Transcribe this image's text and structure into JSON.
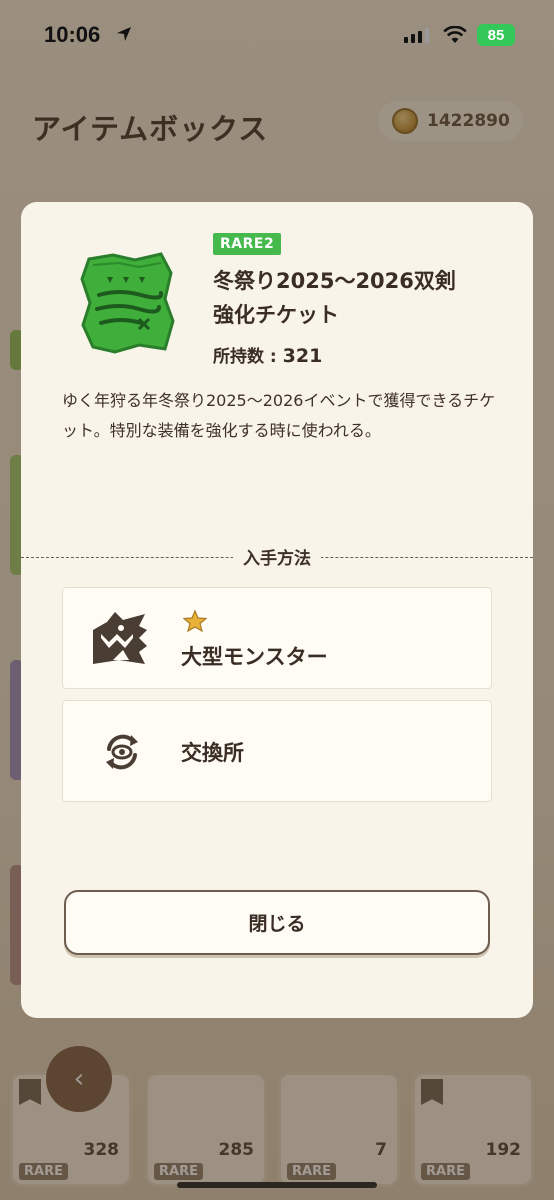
{
  "status_bar": {
    "time": "10:06",
    "battery": "85"
  },
  "background": {
    "title": "アイテムボックス",
    "coins": "1422890",
    "bottom_labels": [
      "",
      "",
      "",
      ""
    ],
    "slots": [
      {
        "count": "328",
        "rarity": "RARE"
      },
      {
        "count": "285",
        "rarity": "RARE"
      },
      {
        "count": "7",
        "rarity": "RARE"
      },
      {
        "count": "192",
        "rarity": "RARE"
      }
    ]
  },
  "modal": {
    "rarity": "RARE2",
    "rarity_color": "#46b94c",
    "item_name_line1": "冬祭り2025〜2026双剣",
    "item_name_line2": "強化チケット",
    "holding_label": "所持数 : ",
    "holding_count": "321",
    "description": "ゆく年狩る年冬祭り2025〜2026イベントで獲得できるチケット。特別な装備を強化する時に使われる。",
    "section_title": "入手方法",
    "sources": [
      {
        "label": "大型モンスター",
        "icon": "monster-icon",
        "stars": 1
      },
      {
        "label": "交換所",
        "icon": "exchange-icon"
      }
    ],
    "close_label": "閉じる"
  }
}
